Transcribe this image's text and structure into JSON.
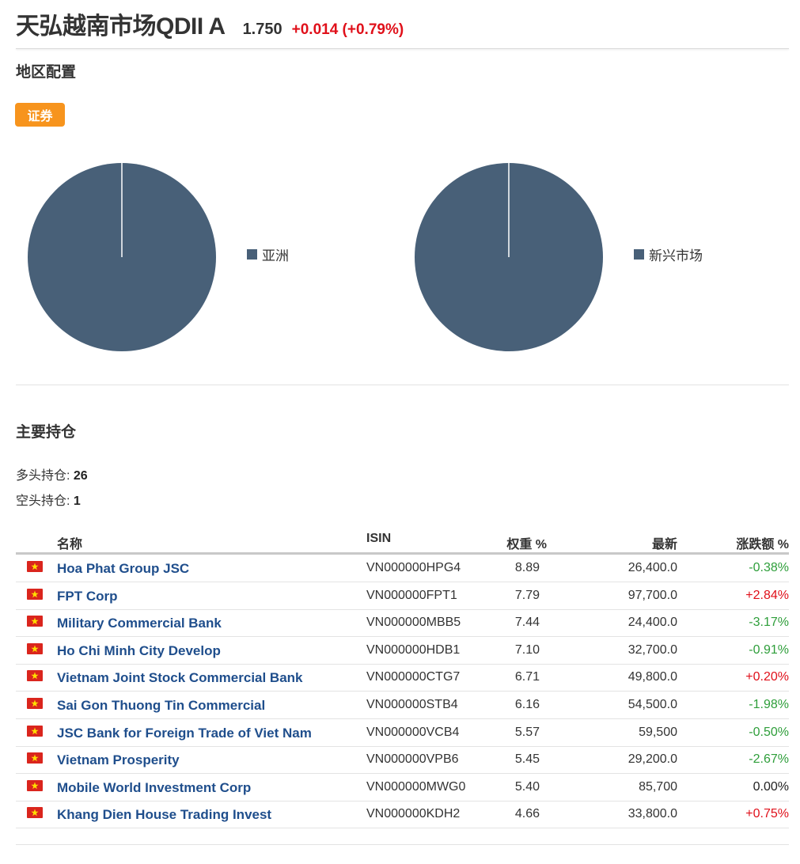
{
  "header": {
    "title": "天弘越南市场QDII A",
    "price": "1.750",
    "change": "+0.014 (+0.79%)"
  },
  "region_section": {
    "title": "地区配置",
    "badge": "证券",
    "charts": [
      {
        "legend": "亚洲",
        "value": 100,
        "color": "#486078"
      },
      {
        "legend": "新兴市场",
        "value": 100,
        "color": "#486078"
      }
    ]
  },
  "holdings_section": {
    "title": "主要持仓",
    "long_label": "多头持仓:",
    "long_count": "26",
    "short_label": "空头持仓:",
    "short_count": "1",
    "columns": {
      "name": "名称",
      "isin": "ISIN",
      "weight": "权重 %",
      "last": "最新",
      "change": "涨跌额 %"
    },
    "rows": [
      {
        "name": "Hoa Phat Group JSC",
        "isin": "VN000000HPG4",
        "weight": "8.89",
        "last": "26,400.0",
        "change": "-0.38%",
        "dir": "down"
      },
      {
        "name": "FPT Corp",
        "isin": "VN000000FPT1",
        "weight": "7.79",
        "last": "97,700.0",
        "change": "+2.84%",
        "dir": "up"
      },
      {
        "name": "Military Commercial Bank",
        "isin": "VN000000MBB5",
        "weight": "7.44",
        "last": "24,400.0",
        "change": "-3.17%",
        "dir": "down"
      },
      {
        "name": "Ho Chi Minh City Develop",
        "isin": "VN000000HDB1",
        "weight": "7.10",
        "last": "32,700.0",
        "change": "-0.91%",
        "dir": "down"
      },
      {
        "name": "Vietnam Joint Stock Commercial Bank",
        "isin": "VN000000CTG7",
        "weight": "6.71",
        "last": "49,800.0",
        "change": "+0.20%",
        "dir": "up"
      },
      {
        "name": "Sai Gon Thuong Tin Commercial",
        "isin": "VN000000STB4",
        "weight": "6.16",
        "last": "54,500.0",
        "change": "-1.98%",
        "dir": "down"
      },
      {
        "name": "JSC Bank for Foreign Trade of Viet Nam",
        "isin": "VN000000VCB4",
        "weight": "5.57",
        "last": "59,500",
        "change": "-0.50%",
        "dir": "down"
      },
      {
        "name": "Vietnam Prosperity",
        "isin": "VN000000VPB6",
        "weight": "5.45",
        "last": "29,200.0",
        "change": "-2.67%",
        "dir": "down"
      },
      {
        "name": "Mobile World Investment Corp",
        "isin": "VN000000MWG0",
        "weight": "5.40",
        "last": "85,700",
        "change": "0.00%",
        "dir": "flat"
      },
      {
        "name": "Khang Dien House Trading Invest",
        "isin": "VN000000KDH2",
        "weight": "4.66",
        "last": "33,800.0",
        "change": "+0.75%",
        "dir": "up"
      }
    ]
  }
}
